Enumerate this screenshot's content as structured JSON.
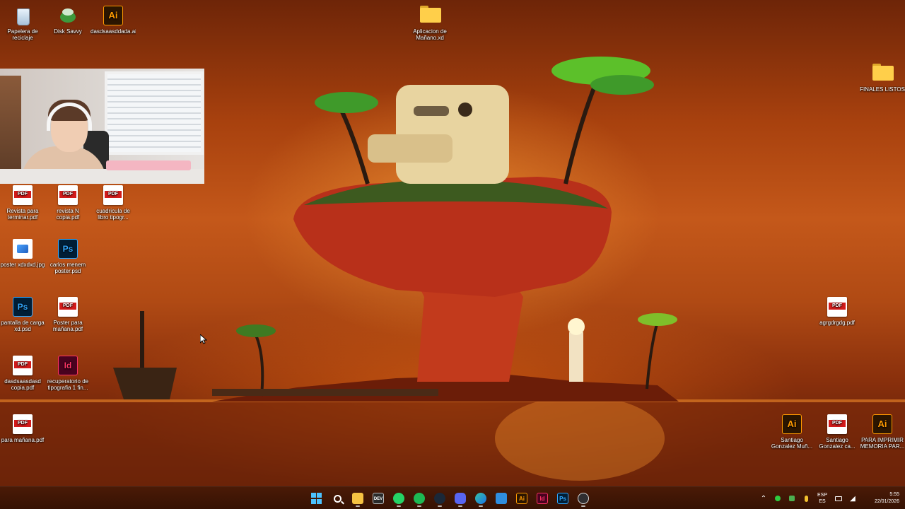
{
  "desktop": {
    "icons": [
      {
        "label": "Papelera de reciclaje",
        "icon": "recycle-bin-icon"
      },
      {
        "label": "Disk Savvy",
        "icon": "disk-savvy-icon"
      },
      {
        "label": "dasdsaasddada.ai",
        "icon": "illustrator-file-icon",
        "badge": "Ai"
      },
      {
        "label": "Aplicacion de Mañano.xd",
        "icon": "folder-icon"
      },
      {
        "label": "FINALES LISTOS",
        "icon": "folder-icon"
      },
      {
        "label": "Revista para terminar.pdf",
        "icon": "pdf-file-icon",
        "badge": "PDF"
      },
      {
        "label": "revista N copia.pdf",
        "icon": "pdf-file-icon",
        "badge": "PDF"
      },
      {
        "label": "cuadricula de libro tipogr...",
        "icon": "pdf-file-icon",
        "badge": "PDF"
      },
      {
        "label": "poster xdxdxd.jpg",
        "icon": "image-file-icon"
      },
      {
        "label": "carlos menem poster.psd",
        "icon": "photoshop-file-icon",
        "badge": "Ps"
      },
      {
        "label": "pantalla de carga xd.psd",
        "icon": "photoshop-file-icon",
        "badge": "Ps"
      },
      {
        "label": "Poster para mañana.pdf",
        "icon": "pdf-file-icon",
        "badge": "PDF"
      },
      {
        "label": "dasdsaasdasd copia.pdf",
        "icon": "pdf-file-icon",
        "badge": "PDF"
      },
      {
        "label": "recuperatorio de tipografia 1 fin...",
        "icon": "indesign-file-icon",
        "badge": "Id"
      },
      {
        "label": "para mañana.pdf",
        "icon": "pdf-file-icon",
        "badge": "PDF"
      },
      {
        "label": "agrgdrgdg.pdf",
        "icon": "pdf-file-icon",
        "badge": "PDF"
      },
      {
        "label": "Santiago Gonzalez Muñ...",
        "icon": "illustrator-file-icon",
        "badge": "Ai"
      },
      {
        "label": "Santiago Gonzalez ca...",
        "icon": "pdf-file-icon",
        "badge": "PDF"
      },
      {
        "label": "PARA IMPRIMIR MEMORIA PAR...",
        "icon": "illustrator-file-icon",
        "badge": "Ai"
      }
    ]
  },
  "taskbar": {
    "apps": [
      {
        "name": "start",
        "icon": "windows-start-icon"
      },
      {
        "name": "search",
        "icon": "search-icon"
      },
      {
        "name": "file-explorer",
        "icon": "folder-icon"
      },
      {
        "name": "dev-app",
        "icon": "terminal-icon",
        "badge": "DEV"
      },
      {
        "name": "whatsapp",
        "icon": "whatsapp-icon"
      },
      {
        "name": "spotify",
        "icon": "spotify-icon"
      },
      {
        "name": "steam",
        "icon": "steam-icon"
      },
      {
        "name": "discord",
        "icon": "discord-icon"
      },
      {
        "name": "edge",
        "icon": "edge-icon"
      },
      {
        "name": "store",
        "icon": "store-icon"
      },
      {
        "name": "illustrator",
        "icon": "illustrator-icon",
        "badge": "Ai"
      },
      {
        "name": "indesign",
        "icon": "indesign-icon",
        "badge": "Id"
      },
      {
        "name": "photoshop",
        "icon": "photoshop-icon",
        "badge": "Ps"
      },
      {
        "name": "obs",
        "icon": "obs-icon"
      }
    ],
    "tray": {
      "language_top": "ESP",
      "language_bottom": "ES",
      "time": "5:55",
      "date": "22/01/2026"
    }
  },
  "colors": {
    "taskbar_bg": "#3e1505",
    "wallpaper_accent": "#c4581a"
  }
}
